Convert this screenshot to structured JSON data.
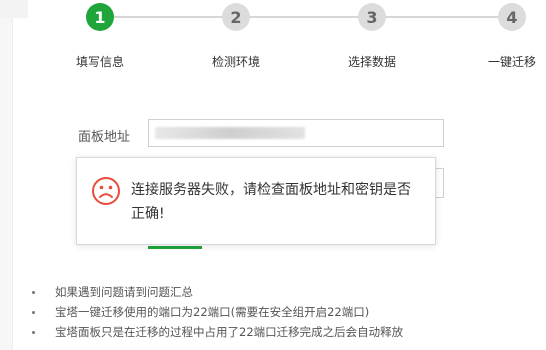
{
  "stepper": {
    "steps": [
      {
        "number": "1",
        "label": "填写信息",
        "state": "active"
      },
      {
        "number": "2",
        "label": "检测环境",
        "state": "inactive"
      },
      {
        "number": "3",
        "label": "选择数据",
        "state": "inactive"
      },
      {
        "number": "4",
        "label": "一键迁移",
        "state": "inactive"
      }
    ]
  },
  "form": {
    "panel_address_label": "面板地址",
    "panel_address_value": ""
  },
  "alert": {
    "icon": "sad-face-icon",
    "message": "连接服务器失败，请检查面板地址和密钥是否正确!"
  },
  "notes": [
    "如果遇到问题请到问题汇总",
    "宝塔一键迁移使用的端口为22端口(需要在安全组开启22端口)",
    "宝塔面板只是在迁移的过程中占用了22端口迁移完成之后会自动释放"
  ],
  "colors": {
    "accent": "#20a53a",
    "error": "#e74c3c",
    "inactive": "#dcdcdc"
  }
}
